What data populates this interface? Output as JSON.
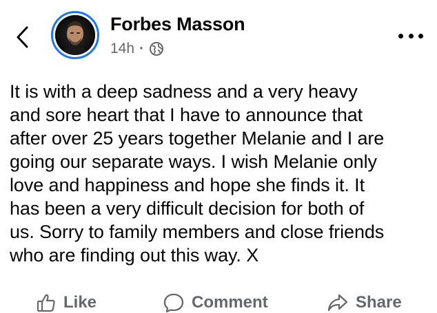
{
  "header": {
    "back_icon": "chevron-left-icon",
    "author_name": "Forbes Masson",
    "timestamp": "14h",
    "separator": "·",
    "privacy_icon": "globe-icon",
    "more_icon": "more-horizontal-icon",
    "avatar_ring_color": "#1877f2"
  },
  "post": {
    "text": "It is with a deep sadness and a very heavy\nand sore heart that I have to announce that\nafter over 25 years together Melanie and I are\ngoing our separate ways. I wish Melanie only\nlove and happiness and hope she finds it. It\nhas been a very difficult decision for both of\nus. Sorry to family members and close friends\nwho are finding out this way.  X"
  },
  "actions": {
    "like_label": "Like",
    "like_icon": "thumbs-up-icon",
    "comment_label": "Comment",
    "comment_icon": "speech-bubble-icon",
    "share_label": "Share",
    "share_icon": "share-arrow-icon"
  },
  "colors": {
    "text": "#050505",
    "secondary": "#65676b",
    "accent": "#1877f2"
  }
}
